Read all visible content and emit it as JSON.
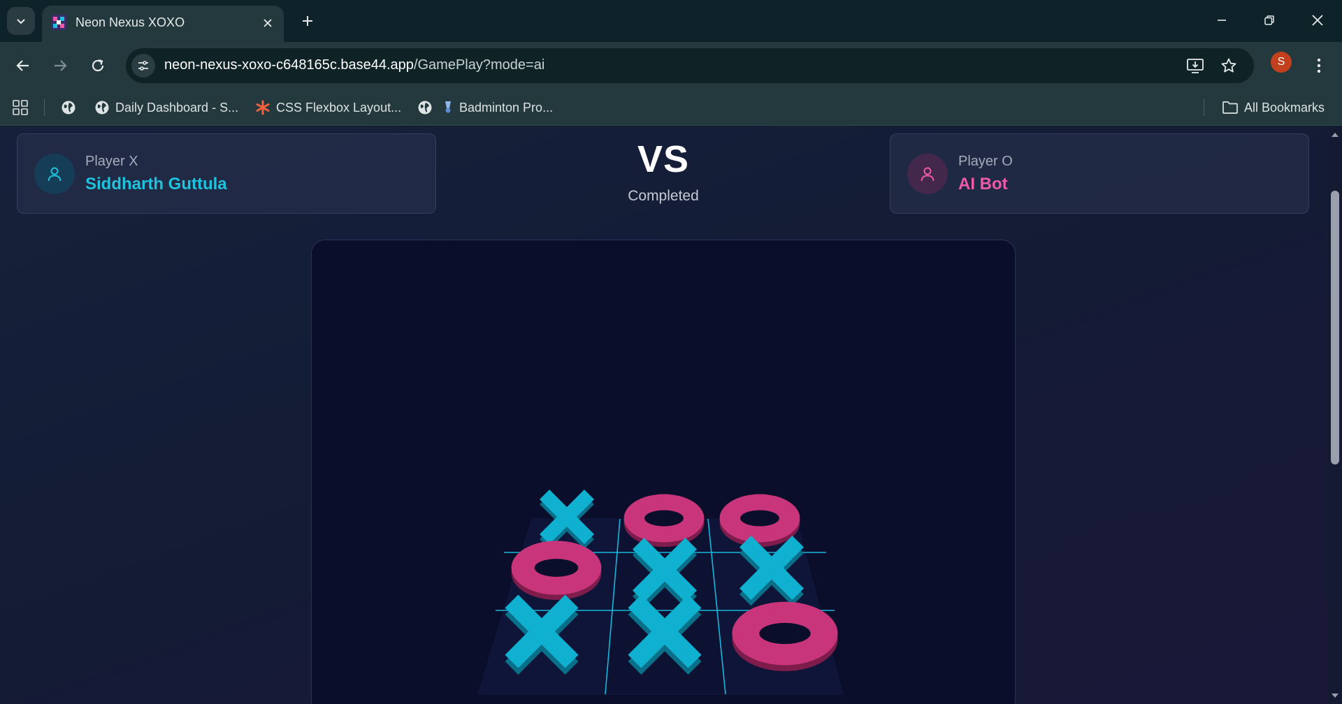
{
  "browser": {
    "tab_title": "Neon Nexus XOXO",
    "url_host": "neon-nexus-xoxo-c648165c.base44.app",
    "url_path": "/GamePlay?mode=ai",
    "profile_initial": "S",
    "bookmarks": [
      {
        "label": "Daily Dashboard - S...",
        "icon": "globe-icon"
      },
      {
        "label": "CSS Flexbox Layout...",
        "icon": "asterisk-icon"
      },
      {
        "label": "Badminton Pro...",
        "icon": "shuttlecock-icon"
      }
    ],
    "all_bookmarks_label": "All Bookmarks"
  },
  "game": {
    "player_x": {
      "role": "Player X",
      "name": "Siddharth Guttula",
      "color": "#1fc2dc"
    },
    "player_o": {
      "role": "Player O",
      "name": "AI Bot",
      "color": "#ee5aa6"
    },
    "vs_label": "VS",
    "status": "Completed",
    "board": [
      [
        "X",
        "O",
        "O"
      ],
      [
        "O",
        "X",
        "X"
      ],
      [
        "X",
        "X",
        "O"
      ]
    ],
    "colors": {
      "x_piece": "#10b0d0",
      "o_piece": "#c8357a",
      "grid_line": "#17b7dc"
    }
  }
}
